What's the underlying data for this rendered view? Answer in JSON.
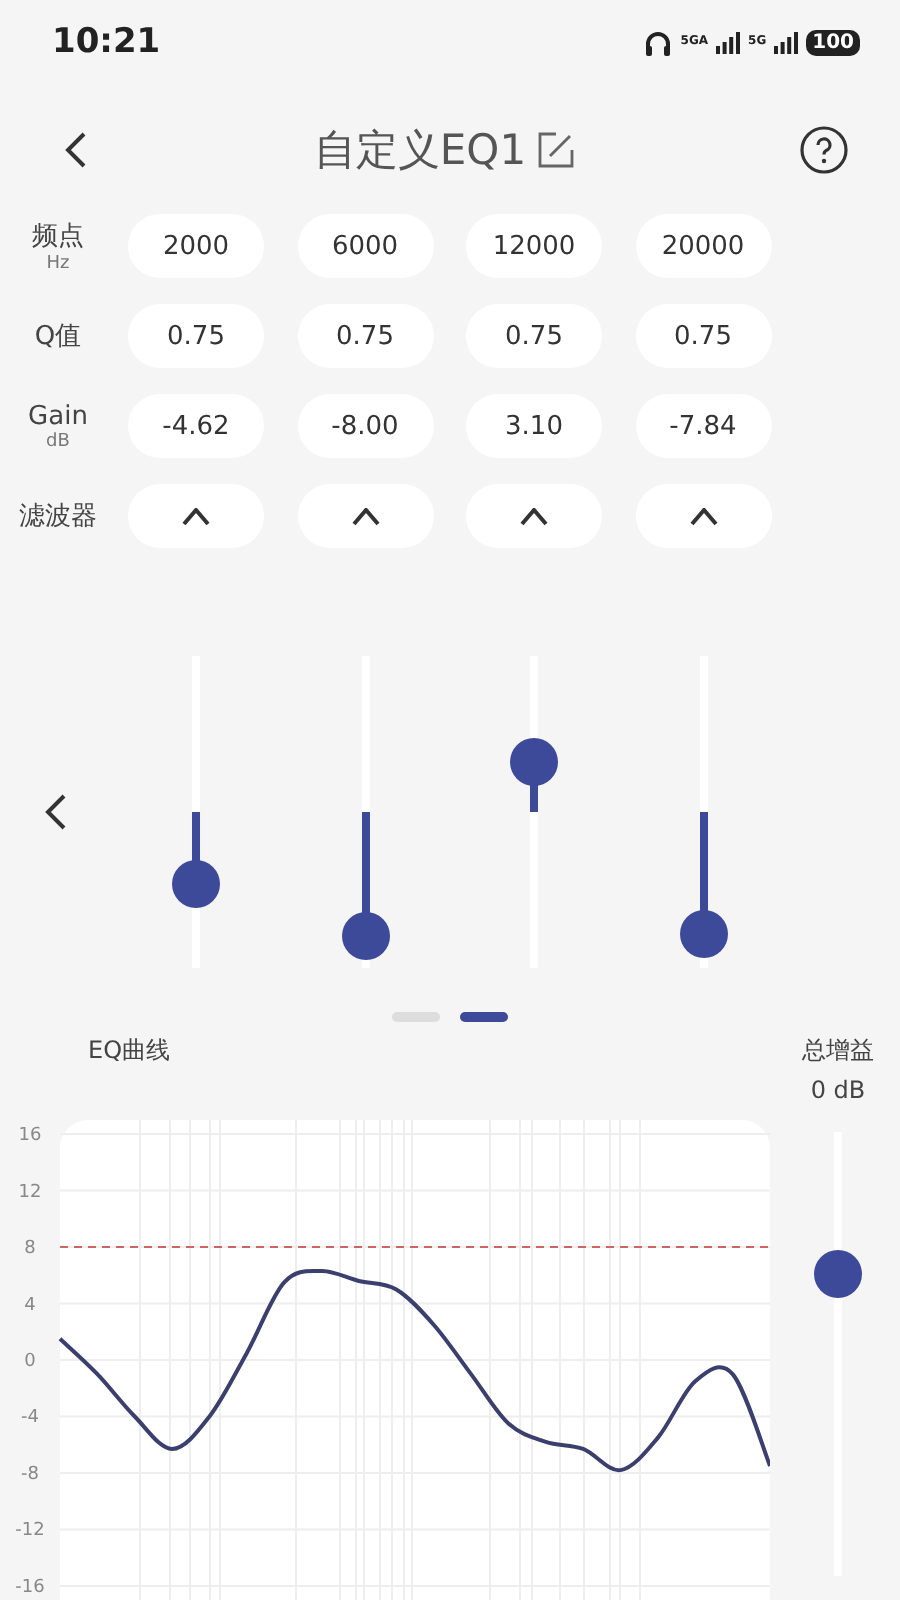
{
  "status_bar": {
    "time": "10:21",
    "signal_1": "5GA",
    "signal_2": "5G",
    "battery": "100"
  },
  "header": {
    "title": "自定义EQ1"
  },
  "table": {
    "rows": [
      {
        "kind": "text",
        "label": "频点",
        "unit": "Hz",
        "cells": [
          "2000",
          "6000",
          "12000",
          "20000"
        ]
      },
      {
        "kind": "text",
        "label": "Q值",
        "cells": [
          "0.75",
          "0.75",
          "0.75",
          "0.75"
        ]
      },
      {
        "kind": "text",
        "label": "Gain",
        "unit": "dB",
        "cells": [
          "-4.62",
          "-8.00",
          "3.10",
          "-7.84"
        ]
      },
      {
        "kind": "filter",
        "label": "滤波器",
        "cells": [
          {
            "kind": "peak"
          },
          {
            "kind": "peak"
          },
          {
            "kind": "peak"
          },
          {
            "kind": "peak"
          }
        ]
      }
    ]
  },
  "bands": [
    {
      "level": 0.27
    },
    {
      "level": 0.1
    },
    {
      "level": 0.66
    },
    {
      "level": 0.11
    }
  ],
  "pager": [
    {
      "selected": false
    },
    {
      "selected": true
    }
  ],
  "curve": {
    "title": "EQ曲线",
    "chart_data": {
      "type": "line",
      "ylim": [
        -17,
        17
      ],
      "grid": true,
      "yticks": [
        16,
        12,
        8,
        4,
        0,
        -4,
        -8,
        -12,
        -16
      ],
      "ref_lines": [
        {
          "axis": "y",
          "value": 8
        }
      ],
      "series": [
        {
          "color": "#3a3f6e",
          "values": [
            1.5,
            -1,
            -4,
            -6.3,
            -4,
            0.5,
            5.5,
            6.3,
            5.6,
            5,
            2.5,
            -1,
            -4.5,
            -5.8,
            -6.3,
            -7.8,
            -5.5,
            -1.5,
            -1,
            -7.5
          ]
        }
      ]
    }
  },
  "total_gain": {
    "title": "总增益",
    "reading": "0 dB",
    "level": 0.7
  }
}
